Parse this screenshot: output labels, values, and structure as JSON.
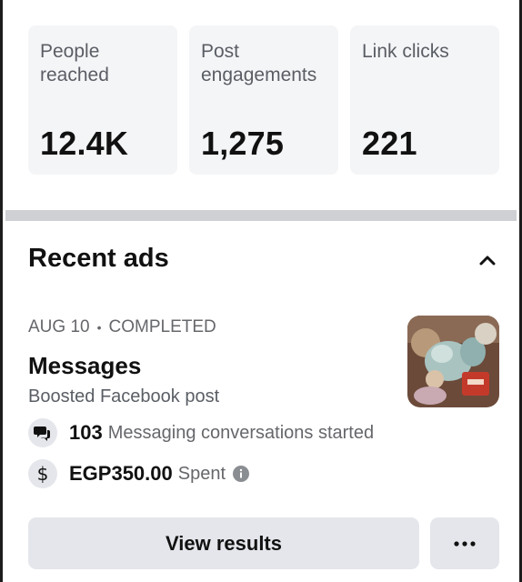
{
  "stats": [
    {
      "label": "People\nreached",
      "value": "12.4K"
    },
    {
      "label": "Post\nengagements",
      "value": "1,275"
    },
    {
      "label": "Link clicks",
      "value": "221"
    }
  ],
  "recent_ads": {
    "title": "Recent ads",
    "collapse_icon": "chevron-up-icon"
  },
  "ad": {
    "date": "AUG 10",
    "status": "COMPLETED",
    "separator": "•",
    "title": "Messages",
    "subtitle": "Boosted Facebook post",
    "thumbnail_icon": "ad-thumbnail-image",
    "metrics": [
      {
        "icon": "messenger-conversations-icon",
        "value": "103",
        "label": "Messaging conversations started"
      },
      {
        "icon": "dollar-icon",
        "value": "EGP350.00",
        "label": "Spent",
        "has_info": true
      }
    ]
  },
  "actions": {
    "view_results": "View results",
    "more_icon": "more-options-icon"
  },
  "colors": {
    "card_bg": "#f4f5f7",
    "divider": "#ced0d4",
    "button_bg": "#e4e6eb",
    "secondary_text": "#65676b"
  }
}
